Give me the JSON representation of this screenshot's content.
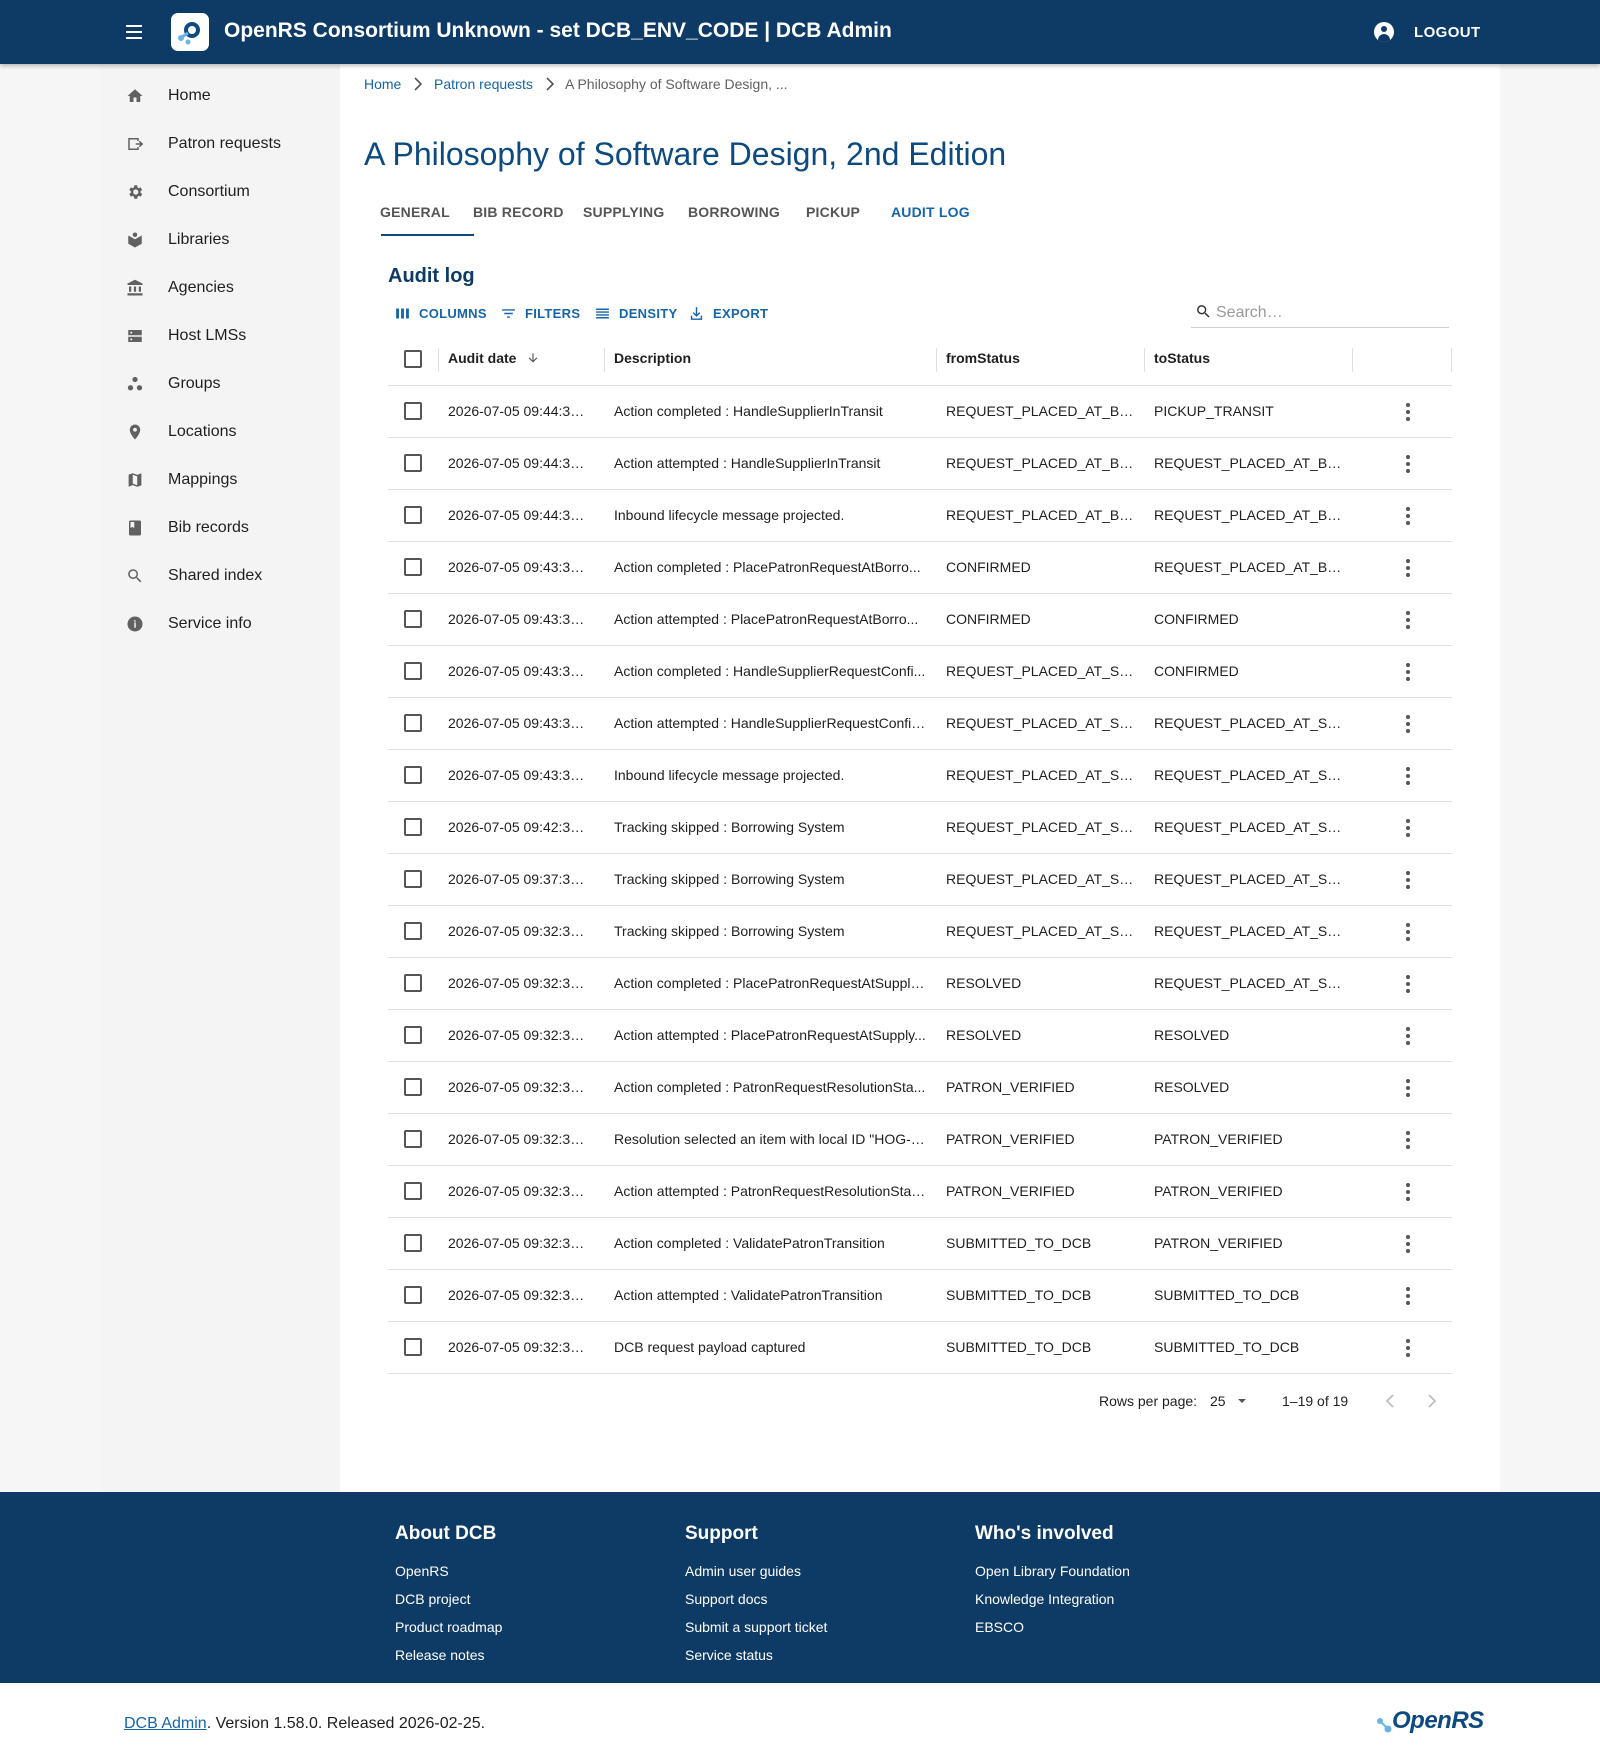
{
  "header": {
    "title": "OpenRS Consortium Unknown - set DCB_ENV_CODE | DCB Admin",
    "logout_label": "LOGOUT"
  },
  "sidebar": {
    "items": [
      {
        "label": "Home",
        "icon": "home-icon"
      },
      {
        "label": "Patron requests",
        "icon": "patron-requests-icon"
      },
      {
        "label": "Consortium",
        "icon": "gear-icon"
      },
      {
        "label": "Libraries",
        "icon": "libraries-icon"
      },
      {
        "label": "Agencies",
        "icon": "agencies-icon"
      },
      {
        "label": "Host LMSs",
        "icon": "host-lms-icon"
      },
      {
        "label": "Groups",
        "icon": "groups-icon"
      },
      {
        "label": "Locations",
        "icon": "location-pin-icon"
      },
      {
        "label": "Mappings",
        "icon": "map-icon"
      },
      {
        "label": "Bib records",
        "icon": "book-icon"
      },
      {
        "label": "Shared index",
        "icon": "search-icon"
      },
      {
        "label": "Service info",
        "icon": "info-icon"
      }
    ]
  },
  "breadcrumb": {
    "home": "Home",
    "patron_requests": "Patron requests",
    "current": "A Philosophy of Software Design, ..."
  },
  "page_title": "A Philosophy of Software Design, 2nd Edition",
  "tabs": {
    "general": "GENERAL",
    "bib_record": "BIB RECORD",
    "supplying": "SUPPLYING",
    "borrowing": "BORROWING",
    "pickup": "PICKUP",
    "audit_log": "AUDIT LOG"
  },
  "audit_log": {
    "title": "Audit log",
    "toolbar": {
      "columns": "COLUMNS",
      "filters": "FILTERS",
      "density": "DENSITY",
      "export": "EXPORT"
    },
    "search_placeholder": "Search…",
    "columns": {
      "audit_date": "Audit date",
      "description": "Description",
      "from_status": "fromStatus",
      "to_status": "toStatus"
    },
    "rows": [
      {
        "date": "2026-07-05 09:44:33....",
        "desc": "Action completed : HandleSupplierInTransit",
        "from": "REQUEST_PLACED_AT_BOR...",
        "to": "PICKUP_TRANSIT"
      },
      {
        "date": "2026-07-05 09:44:33....",
        "desc": "Action attempted : HandleSupplierInTransit",
        "from": "REQUEST_PLACED_AT_BOR...",
        "to": "REQUEST_PLACED_AT_BOR..."
      },
      {
        "date": "2026-07-05 09:44:33....",
        "desc": "Inbound lifecycle message projected.",
        "from": "REQUEST_PLACED_AT_BOR...",
        "to": "REQUEST_PLACED_AT_BOR..."
      },
      {
        "date": "2026-07-05 09:43:32....",
        "desc": "Action completed : PlacePatronRequestAtBorro...",
        "from": "CONFIRMED",
        "to": "REQUEST_PLACED_AT_BOR..."
      },
      {
        "date": "2026-07-05 09:43:32....",
        "desc": "Action attempted : PlacePatronRequestAtBorro...",
        "from": "CONFIRMED",
        "to": "CONFIRMED"
      },
      {
        "date": "2026-07-05 09:43:32....",
        "desc": "Action completed : HandleSupplierRequestConfi...",
        "from": "REQUEST_PLACED_AT_SUP...",
        "to": "CONFIRMED"
      },
      {
        "date": "2026-07-05 09:43:32....",
        "desc": "Action attempted : HandleSupplierRequestConfir...",
        "from": "REQUEST_PLACED_AT_SUP...",
        "to": "REQUEST_PLACED_AT_SUP..."
      },
      {
        "date": "2026-07-05 09:43:32....",
        "desc": "Inbound lifecycle message projected.",
        "from": "REQUEST_PLACED_AT_SUP...",
        "to": "REQUEST_PLACED_AT_SUP..."
      },
      {
        "date": "2026-07-05 09:42:35....",
        "desc": "Tracking skipped : Borrowing System",
        "from": "REQUEST_PLACED_AT_SUP...",
        "to": "REQUEST_PLACED_AT_SUP..."
      },
      {
        "date": "2026-07-05 09:37:35....",
        "desc": "Tracking skipped : Borrowing System",
        "from": "REQUEST_PLACED_AT_SUP...",
        "to": "REQUEST_PLACED_AT_SUP..."
      },
      {
        "date": "2026-07-05 09:32:35....",
        "desc": "Tracking skipped : Borrowing System",
        "from": "REQUEST_PLACED_AT_SUP...",
        "to": "REQUEST_PLACED_AT_SUP..."
      },
      {
        "date": "2026-07-05 09:32:33....",
        "desc": "Action completed : PlacePatronRequestAtSupply...",
        "from": "RESOLVED",
        "to": "REQUEST_PLACED_AT_SUP..."
      },
      {
        "date": "2026-07-05 09:32:33....",
        "desc": "Action attempted : PlacePatronRequestAtSupply...",
        "from": "RESOLVED",
        "to": "RESOLVED"
      },
      {
        "date": "2026-07-05 09:32:33....",
        "desc": "Action completed : PatronRequestResolutionSta...",
        "from": "PATRON_VERIFIED",
        "to": "RESOLVED"
      },
      {
        "date": "2026-07-05 09:32:33....",
        "desc": "Resolution selected an item with local ID \"HOG-F...",
        "from": "PATRON_VERIFIED",
        "to": "PATRON_VERIFIED"
      },
      {
        "date": "2026-07-05 09:32:33....",
        "desc": "Action attempted : PatronRequestResolutionStat...",
        "from": "PATRON_VERIFIED",
        "to": "PATRON_VERIFIED"
      },
      {
        "date": "2026-07-05 09:32:32....",
        "desc": "Action completed : ValidatePatronTransition",
        "from": "SUBMITTED_TO_DCB",
        "to": "PATRON_VERIFIED"
      },
      {
        "date": "2026-07-05 09:32:32....",
        "desc": "Action attempted : ValidatePatronTransition",
        "from": "SUBMITTED_TO_DCB",
        "to": "SUBMITTED_TO_DCB"
      },
      {
        "date": "2026-07-05 09:32:32....",
        "desc": "DCB request payload captured",
        "from": "SUBMITTED_TO_DCB",
        "to": "SUBMITTED_TO_DCB"
      }
    ],
    "pagination": {
      "rows_per_page_label": "Rows per page:",
      "rows_per_page": "25",
      "range": "1–19 of 19"
    }
  },
  "footer": {
    "about": {
      "title": "About DCB",
      "links": [
        "OpenRS",
        "DCB project",
        "Product roadmap",
        "Release notes"
      ]
    },
    "support": {
      "title": "Support",
      "links": [
        "Admin user guides",
        "Support docs",
        "Submit a support ticket",
        "Service status"
      ]
    },
    "involved": {
      "title": "Who's involved",
      "links": [
        "Open Library Foundation",
        "Knowledge Integration",
        "EBSCO"
      ]
    },
    "version_link": "DCB Admin",
    "version_text": ". Version 1.58.0. Released 2026-02-25.",
    "logo_text": "OpenRS"
  },
  "colors": {
    "brand_navy": "#0d3b66",
    "link_blue": "#1565a8",
    "title_blue": "#0d4a80"
  }
}
